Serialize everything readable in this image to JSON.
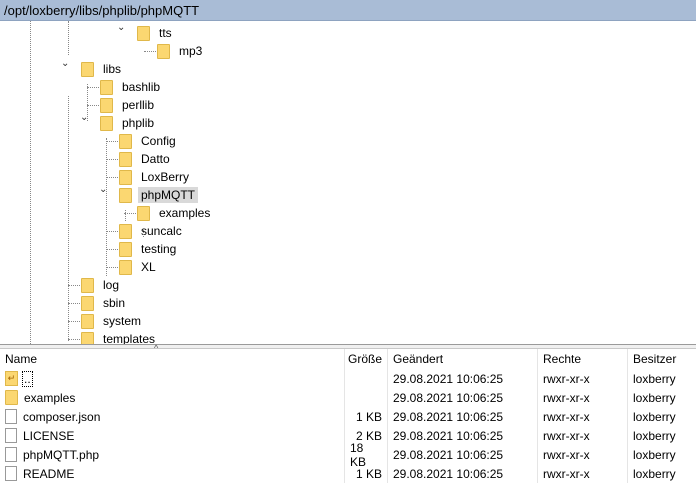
{
  "path": "/opt/loxberry/libs/phplib/phpMQTT",
  "tree": [
    {
      "label": "tts",
      "level": 3,
      "expanded": true
    },
    {
      "label": "mp3",
      "level": 4
    },
    {
      "label": "libs",
      "level": 0,
      "expanded": true
    },
    {
      "label": "bashlib",
      "level": 1
    },
    {
      "label": "perllib",
      "level": 1
    },
    {
      "label": "phplib",
      "level": 1,
      "expanded": true
    },
    {
      "label": "Config",
      "level": 2
    },
    {
      "label": "Datto",
      "level": 2
    },
    {
      "label": "LoxBerry",
      "level": 2
    },
    {
      "label": "phpMQTT",
      "level": 2,
      "expanded": true,
      "selected": true
    },
    {
      "label": "examples",
      "level": 3
    },
    {
      "label": "suncalc",
      "level": 2
    },
    {
      "label": "testing",
      "level": 2
    },
    {
      "label": "XL",
      "level": 2
    },
    {
      "label": "log",
      "level": 0
    },
    {
      "label": "sbin",
      "level": 0
    },
    {
      "label": "system",
      "level": 0
    },
    {
      "label": "templates",
      "level": 0
    }
  ],
  "columns": [
    "Name",
    "Größe",
    "Geändert",
    "Rechte",
    "Besitzer"
  ],
  "files": [
    {
      "name": "..",
      "type": "up",
      "size": "",
      "modified": "29.08.2021 10:06:25",
      "rights": "rwxr-xr-x",
      "owner": "loxberry"
    },
    {
      "name": "examples",
      "type": "folder",
      "size": "",
      "modified": "29.08.2021 10:06:25",
      "rights": "rwxr-xr-x",
      "owner": "loxberry"
    },
    {
      "name": "composer.json",
      "type": "file",
      "size": "1 KB",
      "modified": "29.08.2021 10:06:25",
      "rights": "rwxr-xr-x",
      "owner": "loxberry"
    },
    {
      "name": "LICENSE",
      "type": "file",
      "size": "2 KB",
      "modified": "29.08.2021 10:06:25",
      "rights": "rwxr-xr-x",
      "owner": "loxberry"
    },
    {
      "name": "phpMQTT.php",
      "type": "file",
      "size": "18 KB",
      "modified": "29.08.2021 10:06:25",
      "rights": "rwxr-xr-x",
      "owner": "loxberry"
    },
    {
      "name": "README",
      "type": "file",
      "size": "1 KB",
      "modified": "29.08.2021 10:06:25",
      "rights": "rwxr-xr-x",
      "owner": "loxberry"
    }
  ]
}
